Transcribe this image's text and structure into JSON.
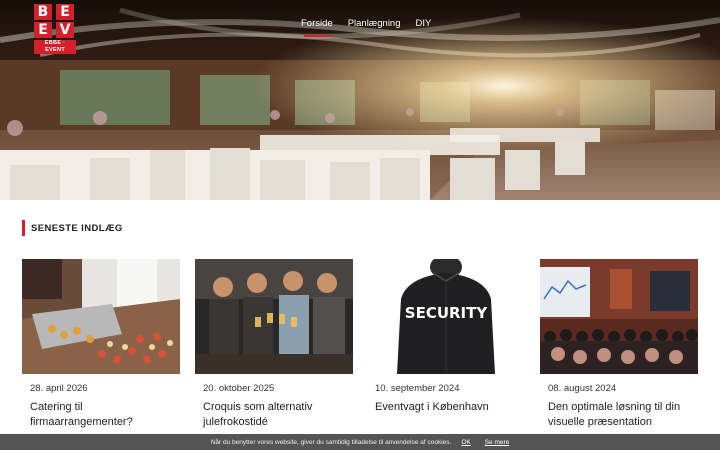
{
  "logo": {
    "letters": [
      "B",
      "E",
      "E",
      "V"
    ],
    "tagline": "EBBE · EVENT"
  },
  "nav": {
    "items": [
      {
        "label": "Forside",
        "active": true
      },
      {
        "label": "Planlægning",
        "active": false
      },
      {
        "label": "DIY",
        "active": false
      }
    ]
  },
  "section": {
    "title": "SENESTE INDLÆG"
  },
  "posts": [
    {
      "date": "28. april 2026",
      "title": "Catering til firmaarrangementer?",
      "image": "catering-buffet-image"
    },
    {
      "date": "20. oktober 2025",
      "title": "Croquis som alternativ julefrokostidé",
      "image": "friends-toasting-image"
    },
    {
      "date": "10. september 2024",
      "title": "Eventvagt i København",
      "image": "security-guard-image"
    },
    {
      "date": "08. august 2024",
      "title": "Den optimale løsning til din visuelle præsentation",
      "image": "conference-presentation-image"
    }
  ],
  "cookie": {
    "text": "Når du benytter vores website, giver du samtidig tilladelse til anvendelse af cookies.",
    "ok_label": "OK",
    "more_label": "Se mere"
  },
  "colors": {
    "accent": "#d4202a",
    "hero_wood": "#4a2f1e",
    "table_white": "#f2ede6"
  }
}
